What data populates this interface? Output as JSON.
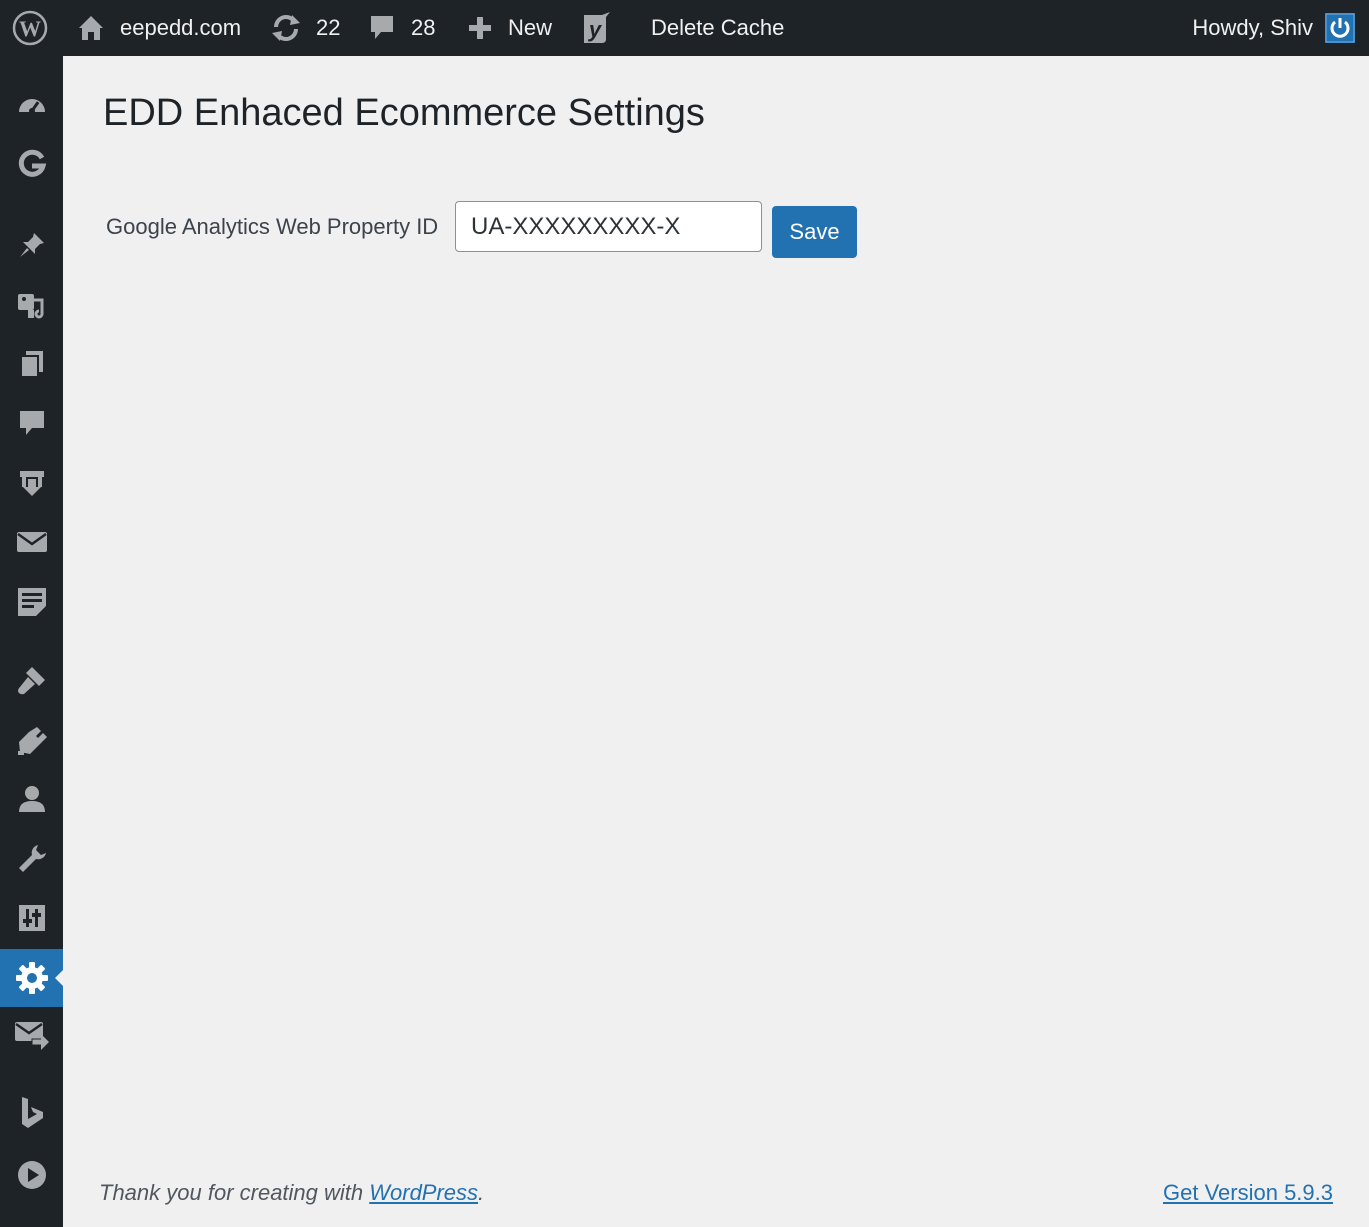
{
  "admin_bar": {
    "site_name": "eepedd.com",
    "updates_count": "22",
    "comments_count": "28",
    "new_label": "New",
    "delete_cache_label": "Delete Cache",
    "greeting": "Howdy, Shiv"
  },
  "sidebar": {
    "icons": [
      "dashboard-icon",
      "google-g-icon",
      "pin-icon",
      "media-icon",
      "pages-icon",
      "comments-icon",
      "downloads-icon",
      "mail-icon",
      "feedback-icon",
      "appearance-icon",
      "plugins-icon",
      "users-icon",
      "tools-icon",
      "settings-sliders-icon",
      "settings-gear-icon",
      "mail-forward-icon",
      "bing-icon",
      "play-icon"
    ],
    "current": "settings-gear-icon"
  },
  "main": {
    "title": "EDD Enhaced Ecommerce Settings",
    "field_label": "Google Analytics Web Property ID",
    "field_value": "UA-XXXXXXXXX-X",
    "save_label": "Save"
  },
  "footer": {
    "thanks_prefix": "Thank you for creating with ",
    "wordpress_link": "WordPress",
    "thanks_suffix": ".",
    "version_link": "Get Version 5.9.3"
  },
  "colors": {
    "adminbar_bg": "#1d2327",
    "accent": "#2271b1",
    "page_bg": "#f0f0f1"
  }
}
